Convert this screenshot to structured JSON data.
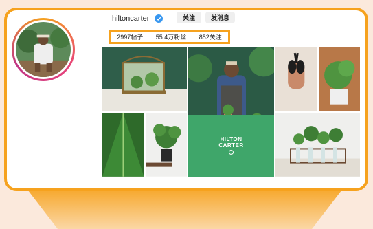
{
  "profile": {
    "username": "hiltoncarter",
    "follow_label": "关注",
    "message_label": "发消息"
  },
  "stats": {
    "posts": "2997帖子",
    "followers": "55.4万粉丝",
    "following": "852关注"
  },
  "brand": {
    "line1": "HILTON",
    "line2": "CARTER"
  },
  "colors": {
    "highlight": "#f6a21e",
    "verified": "#3897f0",
    "brand_green": "#3fa66a"
  }
}
